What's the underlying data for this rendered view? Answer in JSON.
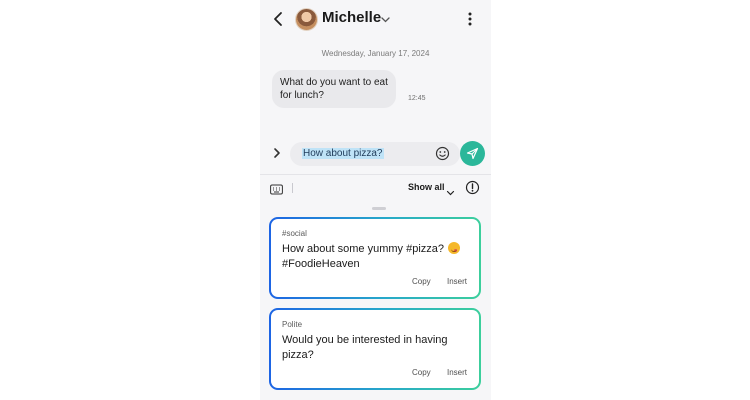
{
  "header": {
    "contact_name": "Michelle"
  },
  "conversation": {
    "date": "Wednesday, January 17, 2024",
    "messages": [
      {
        "text": "What do you want to eat for lunch?",
        "time": "12:45"
      }
    ]
  },
  "composer": {
    "input_value": "How about pizza?"
  },
  "toolbar": {
    "show_all_label": "Show all"
  },
  "suggestions": [
    {
      "tag": "#social",
      "text": "How about some yummy #pizza?",
      "text_line2": "#FoodieHeaven",
      "copy_label": "Copy",
      "insert_label": "Insert"
    },
    {
      "tag": "Polite",
      "text": "Would you be interested in having pizza?",
      "copy_label": "Copy",
      "insert_label": "Insert"
    }
  ],
  "colors": {
    "send_button": "#2bb79a",
    "card_gradient_start": "#1d64e4",
    "card_gradient_end": "#3ccf9c",
    "selection_highlight": "#bfe3f7"
  },
  "icons": [
    "back-icon",
    "avatar",
    "chevron-down-icon",
    "more-options-icon",
    "expand-icon",
    "emoji-icon",
    "send-icon",
    "keyboard-icon",
    "info-icon",
    "smile-emoji-icon"
  ]
}
